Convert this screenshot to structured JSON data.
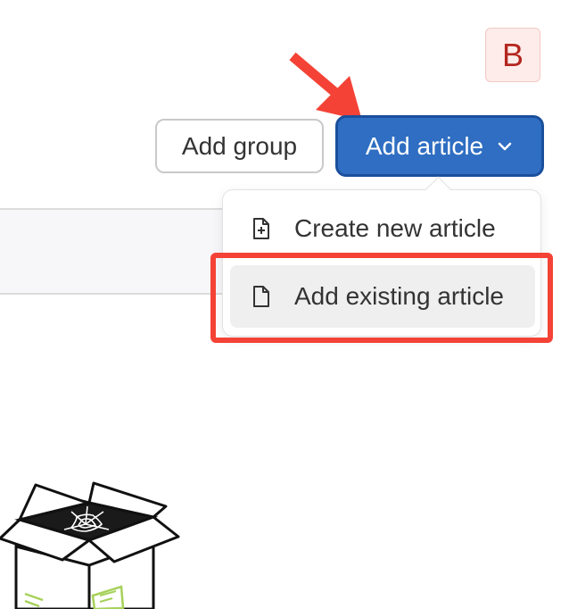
{
  "header": {
    "avatar_initial": "B",
    "add_group_label": "Add group",
    "add_article_label": "Add article",
    "dropdown_icon": "chevron-down-icon"
  },
  "add_article_menu": {
    "items": [
      {
        "label": "Create new article",
        "icon": "file-plus-icon"
      },
      {
        "label": "Add existing article",
        "icon": "file-icon"
      }
    ]
  },
  "annotations": {
    "arrow_color": "#f44336",
    "highlight_color": "#f44336"
  },
  "colors": {
    "primary": "#2f6ec2",
    "avatar_bg": "#fdecea",
    "avatar_text": "#b3261e"
  }
}
